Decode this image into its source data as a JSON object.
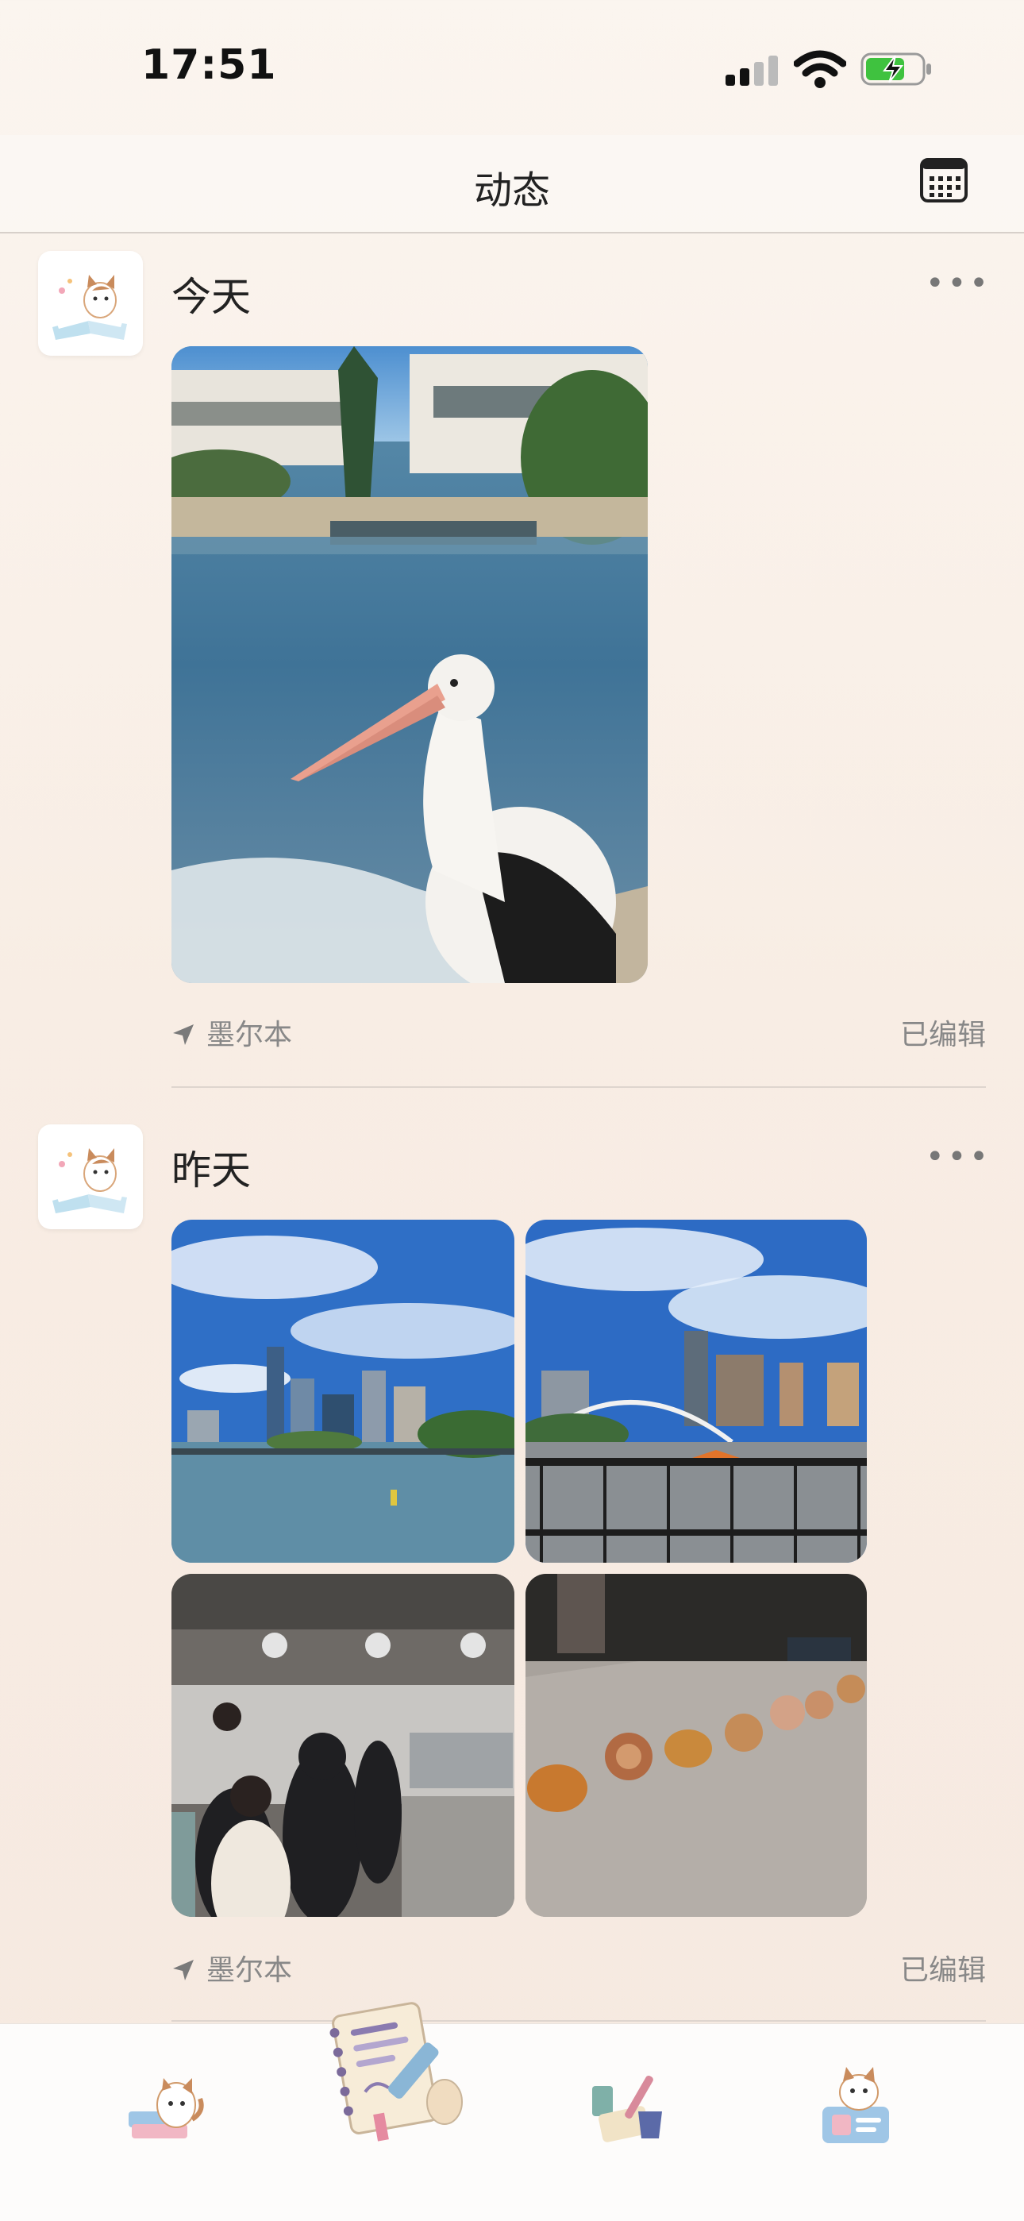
{
  "status_bar": {
    "time": "17:51"
  },
  "nav": {
    "title": "动态",
    "calendar_icon": "calendar-grid-icon"
  },
  "posts": [
    {
      "day": "今天",
      "more": "•••",
      "location": "墨尔本",
      "edited": "已编辑",
      "photos": [
        "pelican-photo"
      ]
    },
    {
      "day": "昨天",
      "more": "•••",
      "location": "墨尔本",
      "edited": "已编辑",
      "photos": [
        "city-river-photo",
        "city-footbridge-photo",
        "cafe-interior-photo",
        "pastries-photo"
      ]
    }
  ],
  "tabbar": {
    "tabs": [
      "cat-reading-tab-icon",
      "journal-tab-icon",
      "art-supplies-tab-icon",
      "cat-profile-tab-icon"
    ]
  },
  "colors": {
    "accent_battery": "#3fc23f",
    "background": "#f8ede4"
  }
}
